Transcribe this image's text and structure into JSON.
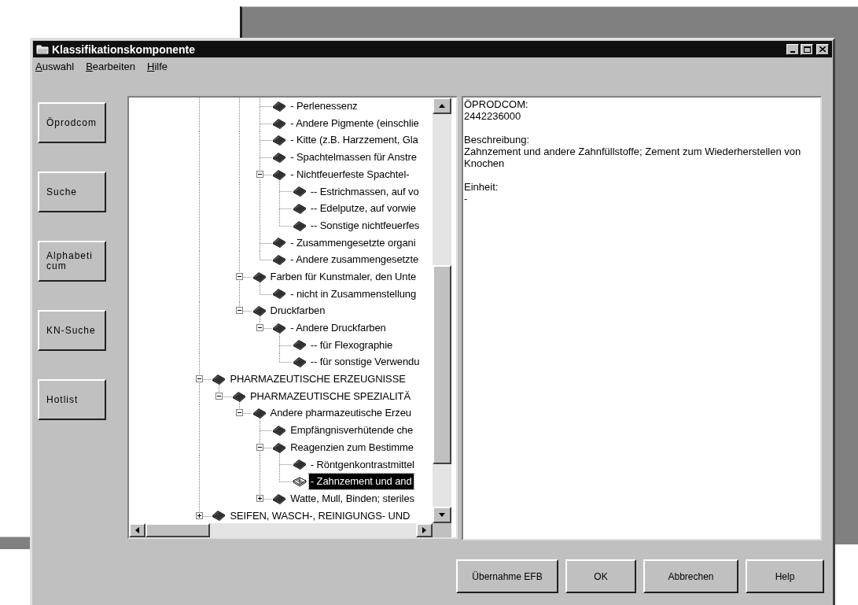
{
  "window": {
    "title": "Klassifikationskomponente"
  },
  "menu": [
    "Auswahl",
    "Bearbeiten",
    "Hilfe"
  ],
  "side_buttons": [
    "Öprodcom",
    "Suche",
    "Alphabeticum",
    "KN-Suche",
    "Hotlist"
  ],
  "tree": {
    "items": [
      {
        "children": [
          {
            "children": [
              {
                "children": [
                  {
                    "label": "- Perlenessenz",
                    "selected": false
                  },
                  {
                    "label": "- Andere Pigmente (einschlie",
                    "selected": false
                  },
                  {
                    "label": "- Kitte (z.B. Harzzement, Gla",
                    "selected": false
                  },
                  {
                    "label": "- Spachtelmassen für Anstre",
                    "selected": false
                  },
                  {
                    "label": "- Nichtfeuerfeste Spachtel-",
                    "selected": false,
                    "expanded": true,
                    "children": [
                      {
                        "label": "-- Estrichmassen, auf vo",
                        "selected": false
                      },
                      {
                        "label": "-- Edelputze, auf vorwie",
                        "selected": false
                      },
                      {
                        "label": "-- Sonstige nichtfeuerfes",
                        "selected": false
                      }
                    ]
                  },
                  {
                    "label": "- Zusammengesetzte organi",
                    "selected": false
                  },
                  {
                    "label": "- Andere zusammengesetzte",
                    "selected": false
                  }
                ]
              },
              {
                "label": "Farben für Kunstmaler, den Unte",
                "selected": false,
                "expanded": true,
                "children": [
                  {
                    "label": "- nicht in Zusammenstellung",
                    "selected": false
                  }
                ]
              },
              {
                "label": "Druckfarben",
                "selected": false,
                "expanded": true,
                "children": [
                  {
                    "label": "- Andere Druckfarben",
                    "selected": false,
                    "expanded": true,
                    "children": [
                      {
                        "label": "-- für Flexographie",
                        "selected": false
                      },
                      {
                        "label": "-- für sonstige Verwendu",
                        "selected": false
                      }
                    ]
                  }
                ]
              }
            ]
          }
        ]
      },
      {
        "label": "PHARMAZEUTISCHE ERZEUGNISSE",
        "selected": false,
        "expanded": true,
        "children": [
          {
            "label": "PHARMAZEUTISCHE SPEZIALITÄ",
            "selected": false,
            "expanded": true,
            "children": [
              {
                "label": "Andere pharmazeutische Erzeu",
                "selected": false,
                "expanded": true,
                "children": [
                  {
                    "label": "Empfängnisverhütende che",
                    "selected": false
                  },
                  {
                    "label": "Reagenzien zum Bestimme",
                    "selected": false,
                    "expanded": true,
                    "children": [
                      {
                        "label": "- Röntgenkontrastmittel",
                        "selected": false
                      },
                      {
                        "label": "- Zahnzement und and",
                        "selected": true
                      }
                    ]
                  },
                  {
                    "label": "Watte, Mull, Binden; steriles",
                    "selected": false,
                    "expanded": false
                  }
                ]
              }
            ]
          }
        ]
      },
      {
        "label": "SEIFEN, WASCH-, REINIGUNGS- UND",
        "selected": false,
        "expanded": false
      }
    ]
  },
  "detail": {
    "fields": [
      {
        "label": "ÖPRODCOM:",
        "value": "2442236000"
      },
      {
        "label": "Beschreibung:",
        "value": "Zahnzement und andere Zahnfüllstoffe; Zement zum Wiederherstellen von Knochen"
      },
      {
        "label": "Einheit:",
        "value": "-"
      }
    ]
  },
  "footer_buttons": [
    "Übernahme EFB",
    "OK",
    "Abbrechen",
    "Help"
  ]
}
